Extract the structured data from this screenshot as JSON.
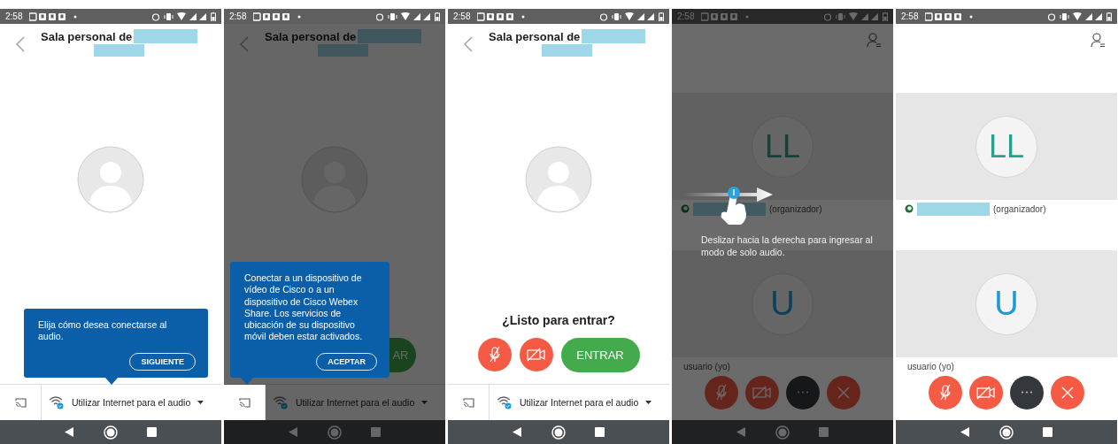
{
  "panels": [
    {
      "kind": "prejoin",
      "time": "2:58",
      "dimmed": false,
      "title": {
        "text": "Sala personal de",
        "redacted": true
      },
      "tooltip": {
        "text": "Elija cómo desea conectarse al audio.",
        "button": "SIGUIENTE"
      },
      "audio_selector": "Utilizar Internet para el audio"
    },
    {
      "kind": "prejoin",
      "time": "2:58",
      "dimmed": true,
      "title": {
        "text": "Sala personal de",
        "redacted": true
      },
      "media_buttons": false,
      "join_button": "AR",
      "tooltip": {
        "text": "Conectar a un dispositivo de vídeo de Cisco o a un dispositivo de Cisco Webex Share. Los servicios de ubicación de su dispositivo móvil deben estar activados.",
        "button": "ACEPTAR"
      },
      "audio_selector": "Utilizar Internet para el audio"
    },
    {
      "kind": "prejoin",
      "time": "2:58",
      "dimmed": false,
      "title": {
        "text": "Sala personal de",
        "redacted": true
      },
      "prompt": "¿Listo para entrar?",
      "media_buttons": true,
      "join_button": "ENTRAR",
      "audio_selector": "Utilizar Internet para el audio"
    },
    {
      "kind": "meeting",
      "time": "2:58",
      "dimmed": true,
      "participants": [
        {
          "initials": "LL",
          "name": "(organizador)",
          "redacted": true
        },
        {
          "initials": "U",
          "name": "usuario (yo)",
          "redacted": false
        }
      ],
      "hint": "Deslizar hacia la derecha para ingresar al modo de solo audio."
    },
    {
      "kind": "meeting",
      "time": "2:58",
      "dimmed": false,
      "participants": [
        {
          "initials": "LL",
          "name": "(organizador)",
          "redacted": true
        },
        {
          "initials": "U",
          "name": "usuario (yo)",
          "redacted": false
        }
      ]
    }
  ]
}
